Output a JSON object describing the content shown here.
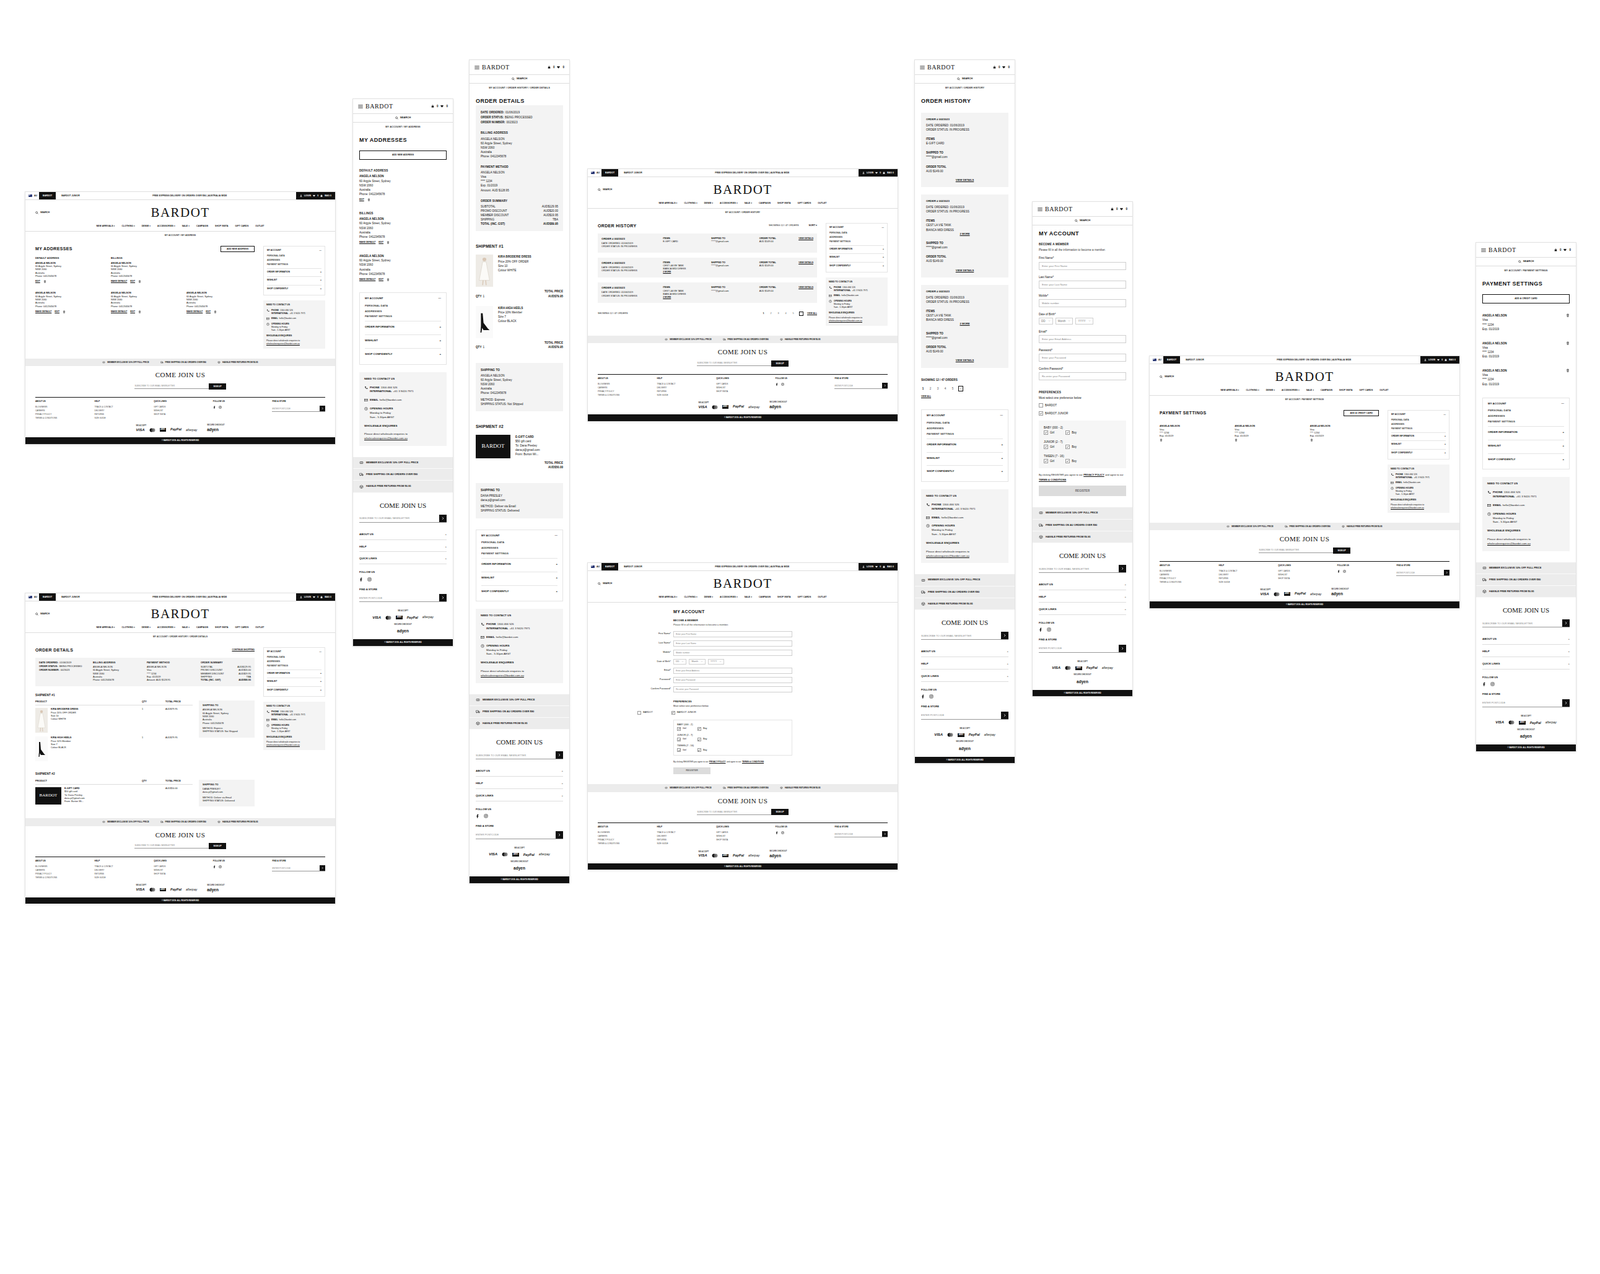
{
  "common": {
    "desktop_header": {
      "flag": "AU",
      "tabs": [
        {
          "label": "BARDOT",
          "selected": true
        },
        {
          "label": "BARDOT JUNIOR",
          "selected": false
        }
      ],
      "promo": "FREE EXPRESS DELIVERY ON ORDERS OVER $80 | AUSTRALIA WIDE",
      "login": "LOGIN",
      "wishlist": "0",
      "bag": "BAG 0",
      "search": "SEARCH",
      "logo": "BARDOT",
      "nav": [
        "NEW ARRIVALS ▾",
        "CLOTHING ▾",
        "DENIM ▾",
        "ACCESSORIES ▾",
        "SALE ▾",
        "CAMPAIGN",
        "SHOP INSTA",
        "GIFT CARDS",
        "OUTLET"
      ]
    },
    "mobile_header": {
      "logo": "BARDOT",
      "bag": "0",
      "wishlist": "0",
      "search": "SEARCH"
    },
    "account_menu": {
      "title": "MY ACCOUNT",
      "toggle": "—",
      "items": [
        "PERSONAL DATA",
        "ADDRESSES",
        "PAYMENT SETTINGS"
      ],
      "sections": [
        {
          "label": "ORDER INFORMATION",
          "icon": "+"
        },
        {
          "label": "WISHLIST",
          "icon": "+"
        },
        {
          "label": "SHOP CONFIDENTLY",
          "icon": "+"
        }
      ]
    },
    "contact": {
      "title": "NEED TO CONTACT US",
      "phone_label": "PHONE",
      "phone": "1300 466 526",
      "intl_label": "INTERNATIONAL",
      "intl": "+61 3 9420 7971",
      "email_label": "EMAIL",
      "email": "hello@bardot.com",
      "hours_label": "OPENING HOURS",
      "hours": "Monday to Friday",
      "hours_time": "9am - 5.30pm AEST",
      "wholesale_title": "WHOLESALE ENQUIRIES",
      "wholesale_text": "Please direct wholesale enquiries to",
      "wholesale_email": "wholesaleenquiries@bardot.com.au"
    },
    "benefits": [
      "MEMBER EXCLUSIVE 10% OFF FULL PRICE",
      "FREE SHIPPING ON AU ORDERS OVER $80",
      "HASSLE FREE RETURNS FROM $6.95"
    ],
    "join": {
      "title": "COME JOIN US",
      "placeholder": "SUBSCRIBE TO OUR EMAIL NEWSLETTER",
      "button": "SIGN UP"
    },
    "footer_columns": [
      {
        "title": "ABOUT US",
        "links": [
          "BLOG/NEWS",
          "CAREERS",
          "PRIVACY POLICY",
          "TERMS & CONDITIONS"
        ]
      },
      {
        "title": "HELP",
        "links": [
          "TRACK & CONTACT",
          "DELIVERY",
          "RETURNS",
          "SIZE GUIDE"
        ]
      },
      {
        "title": "QUICK LINKS",
        "links": [
          "GIFT CARDS",
          "WISHLIST",
          "SHOP INSTA"
        ]
      }
    ],
    "follow": "FOLLOW US",
    "store": {
      "title": "FIND A STORE",
      "placeholder": "ENTER POSTCODE"
    },
    "accept": "WE ACCEPT",
    "cards": [
      "VISA",
      "AMEX",
      "PayPal",
      "afterpay"
    ],
    "secure": "SECURE CHECKOUT",
    "adyen": "adyen",
    "expand": "+",
    "copyright": "© BARDOT 2019. ALL RIGHTS RESERVED"
  },
  "pages": {
    "addresses": {
      "breadcrumb": "MY ACCOUNT / MY ADDRESS",
      "title": "MY ADDRESSES",
      "add": "ADD NEW ADDRESS",
      "addresses": [
        {
          "heading": "DEFAULT ADDRESS",
          "name": "ANGELA NELSON",
          "lines": [
            "60 Argyle Street, Sydney",
            "NSW 2060",
            "Australia",
            "Phone: 0412345678"
          ],
          "actions": [
            "EDIT"
          ]
        },
        {
          "heading": "BILLINGS",
          "name": "ANGELA NELSON",
          "lines": [
            "60 Argyle Street, Sydney",
            "NSW 2060",
            "Australia",
            "Phone: 0412345678"
          ],
          "actions": [
            "MAKE DEFAULT",
            "EDIT"
          ]
        },
        {
          "name": "ANGELA NELSON",
          "lines": [
            "60 Argyle Street, Sydney",
            "NSW 2060",
            "Australia",
            "Phone: 0412345678"
          ],
          "actions": [
            "MAKE DEFAULT",
            "EDIT"
          ]
        },
        {
          "name": "ANGELA NELSON",
          "lines": [
            "60 Argyle Street, Sydney",
            "NSW 2060",
            "Australia",
            "Phone: 0412345678"
          ],
          "actions": [
            "MAKE DEFAULT",
            "EDIT"
          ]
        },
        {
          "name": "ANGELA NELSON",
          "lines": [
            "60 Argyle Street, Sydney",
            "NSW 2060",
            "Australia",
            "Phone: 0412345678"
          ],
          "actions": [
            "MAKE DEFAULT",
            "EDIT"
          ]
        }
      ]
    },
    "order_details": {
      "breadcrumb": "MY ACCOUNT / ORDER HISTORY / ORDER DETAILS",
      "title": "ORDER DETAILS",
      "continue": "CONTINUE SHOPPING",
      "meta": [
        {
          "label": "DATE ORDERED:",
          "value": "01/06/2019"
        },
        {
          "label": "ORDER STATUS:",
          "value": "BEING PROCESSED"
        },
        {
          "label": "ORDER NUMBER:",
          "value": "0023023"
        }
      ],
      "billing": {
        "title": "BILLING ADDRESS",
        "lines": [
          "ANGELA NELSON",
          "60 Argyle Street, Sydney",
          "NSW 2060",
          "Australia",
          "Phone: 0412345678"
        ]
      },
      "payment": {
        "title": "PAYMENT METHOD",
        "lines": [
          "ANGELA NELSON",
          "Visa",
          "**** 1234",
          "Exp. 01/2019",
          "Amount: AUD $128.95"
        ]
      },
      "summary": {
        "title": "ORDER SUMMARY",
        "rows": [
          {
            "label": "SUBTOTAL",
            "value": "AUD$129.95"
          },
          {
            "label": "PROMO DISCOUNT",
            "value": "AUD$20.00"
          },
          {
            "label": "MEMBER DISCOUNT",
            "value": "AUD$19.95"
          },
          {
            "label": "SHIPPING",
            "value": "TBA"
          },
          {
            "label": "TOTAL (INC. GST)",
            "value": "AUD$89.95"
          }
        ]
      },
      "columns": [
        "PRODUCT",
        "QTY",
        "TOTAL PRICE"
      ],
      "shipments": [
        {
          "title": "SHIPMENT #1",
          "items": [
            {
              "kind": "dress",
              "name": "KIRA BRODERIE DRESS",
              "lines": [
                "Price 20% OFF ORDER",
                "Size 10",
                "Colour WHITE"
              ],
              "qty": "1",
              "price": "AUD$79.95"
            },
            {
              "kind": "heels",
              "name": "KIRA HIGH HEELS",
              "lines": [
                "Price 10% Member",
                "Size 7",
                "Colour BLACK"
              ],
              "qty": "1",
              "price": "AUD$79.95"
            }
          ],
          "ship": {
            "title": "SHIPPING TO",
            "lines": [
              "ANGELA NELSON",
              "60 Argyle Street, Sydney",
              "NSW 2060",
              "Australia",
              "Phone: 0412345678"
            ],
            "method": "METHOD: Express",
            "status": "SHIPPING STATUS: Not Shipped"
          }
        },
        {
          "title": "SHIPMENT #2",
          "items": [
            {
              "kind": "giftcard",
              "card_logo": "BARDOT",
              "name": "E-GIFT CARD",
              "lines": [
                "$50 gift card",
                "To: Dana Presley",
                "dana.p@gmail.com",
                "From: Burton Wi..."
              ],
              "qty": "",
              "price": "AUD$50.00"
            }
          ],
          "ship": {
            "title": "SHIPPING TO",
            "lines": [
              "DANA PRESLEY",
              "dana.p@gmail.com"
            ],
            "method": "METHOD: Deliver via Email",
            "status": "SHIPPING STATUS: Delivered"
          }
        }
      ]
    },
    "order_history": {
      "breadcrumb": "MY ACCOUNT / ORDER HISTORY",
      "title": "ORDER HISTORY",
      "showing": "SHOWING 12 / 47 ORDERS",
      "sort": "SORT ▾",
      "orders": [
        {
          "number": "ORDER # 0023023",
          "date": "DATE ORDERED: 01/06/2019",
          "status": "ORDER STATUS: IN PROGRESS",
          "items_label": "ITEMS",
          "items": [
            "E-GIFT CARD"
          ],
          "shipped_label": "SHIPPED TO",
          "shipped": "*****@gmail.com",
          "total_label": "ORDER TOTAL",
          "total": "AUD $149.00",
          "view": "VIEW DETAILS"
        },
        {
          "number": "ORDER # 0023023",
          "date": "DATE ORDERED: 01/06/2019",
          "status": "ORDER STATUS: IN PROGRESS",
          "items_label": "ITEMS",
          "items": [
            "CEST LA VIE TANK",
            "BIANCA MIDI DRESS"
          ],
          "more": "2 MORE",
          "shipped_label": "SHIPPED TO",
          "shipped": "*****@gmail.com",
          "total_label": "ORDER TOTAL",
          "total": "AUD $149.00",
          "view": "VIEW DETAILS"
        },
        {
          "number": "ORDER # 0023023",
          "date": "DATE ORDERED: 01/06/2019",
          "status": "ORDER STATUS: IN PROGRESS",
          "items_label": "ITEMS",
          "items": [
            "CEST LA VIE TANK",
            "BIANCA MIDI DRESS"
          ],
          "more": "2 MORE",
          "shipped_label": "SHIPPED TO",
          "shipped": "*****@gmail.com",
          "total_label": "ORDER TOTAL",
          "total": "AUD $149.00",
          "view": "VIEW DETAILS"
        }
      ],
      "pages": [
        {
          "label": "1",
          "selected": true
        },
        {
          "label": "2",
          "selected": false
        },
        {
          "label": "3",
          "selected": false
        },
        {
          "label": "4",
          "selected": false
        },
        {
          "label": "5",
          "selected": false
        }
      ],
      "next": "›",
      "view_all": "VIEW ALL"
    },
    "account": {
      "title": "MY ACCOUNT",
      "subtitle": "BECOME A MEMBER",
      "intro": "Please fill in all the information to become a member.",
      "fields": [
        {
          "kind": "text",
          "label": "First Name*",
          "placeholder": "Enter your First Name"
        },
        {
          "kind": "text",
          "label": "Last Name*",
          "placeholder": "Enter your Last Name"
        },
        {
          "kind": "text",
          "label": "Mobile*",
          "placeholder": "Mobile number"
        },
        {
          "kind": "date",
          "label": "Date of Birth*",
          "options": [
            "DD",
            "Month",
            "YYYY"
          ]
        },
        {
          "kind": "text",
          "label": "Email*",
          "placeholder": "Enter your Email Address"
        },
        {
          "kind": "text",
          "label": "Password*",
          "placeholder": "Enter your Password"
        },
        {
          "kind": "text",
          "label": "Confirm Password*",
          "placeholder": "Re-enter your Password"
        }
      ],
      "prefs": {
        "title": "PREFERENCES",
        "note": "Must select one preference below",
        "brands": [
          {
            "label": "BARDOT",
            "checked": false
          },
          {
            "label": "BARDOT JUNIOR",
            "checked": true
          }
        ],
        "groups": [
          {
            "label": "BABY (000 - 2)",
            "options": [
              {
                "label": "Girl",
                "checked": true
              },
              {
                "label": "Boy",
                "checked": true
              }
            ]
          },
          {
            "label": "JUNIOR (2 - 7)",
            "options": [
              {
                "label": "Girl",
                "checked": true
              },
              {
                "label": "Boy",
                "checked": true
              }
            ]
          },
          {
            "label": "TWEEN (7 - 16)",
            "options": [
              {
                "label": "Girl",
                "checked": true
              },
              {
                "label": "Boy",
                "checked": true
              }
            ]
          }
        ]
      },
      "consent": [
        "By clicking REGISTER you agree to our",
        "PRIVACY POLICY",
        "and agree to our",
        "TERMS & CONDITIONS"
      ],
      "register": "REGISTER",
      "register_disabled": true
    },
    "payment": {
      "breadcrumb": "MY ACCOUNT / PAYMENT SETTINGS",
      "title": "PAYMENT SETTINGS",
      "add": "ADD A CREDIT CARD",
      "cards": [
        {
          "name": "ANGELA NELSON",
          "type": "Visa",
          "number": "**** 1234",
          "exp": "Exp. 01/2019"
        },
        {
          "name": "ANGELA NELSON",
          "type": "Visa",
          "number": "**** 1234",
          "exp": "Exp. 01/2019"
        },
        {
          "name": "ANGELA NELSON",
          "type": "Visa",
          "number": "**** 1234",
          "exp": "Exp. 01/2019"
        }
      ]
    }
  },
  "screens": [
    {
      "device": "desktop",
      "page": "addresses"
    },
    {
      "device": "desktop",
      "page": "order_details"
    },
    {
      "device": "mobile",
      "page": "addresses"
    },
    {
      "device": "mobile",
      "page": "order_details"
    },
    {
      "device": "desktop",
      "page": "order_history"
    },
    {
      "device": "desktop",
      "page": "account"
    },
    {
      "device": "mobile",
      "page": "order_history"
    },
    {
      "device": "mobile",
      "page": "account"
    },
    {
      "device": "desktop",
      "page": "payment"
    },
    {
      "device": "mobile",
      "page": "payment"
    }
  ]
}
